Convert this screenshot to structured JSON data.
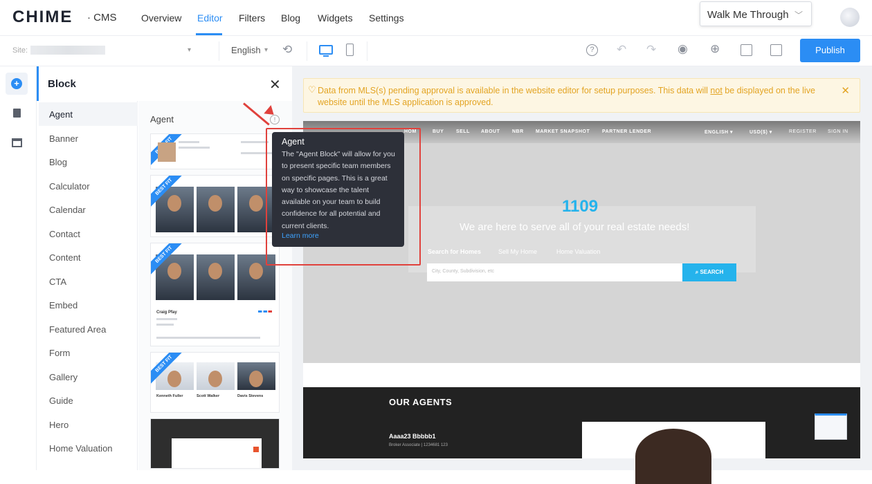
{
  "app": {
    "logo": "CHIME",
    "suffix": "· CMS"
  },
  "nav": {
    "items": [
      "Overview",
      "Editor",
      "Filters",
      "Blog",
      "Widgets",
      "Settings"
    ],
    "active": "Editor"
  },
  "walkthrough": {
    "label": "Walk Me Through"
  },
  "toolbar": {
    "site_label": "Site:",
    "language": "English",
    "publish_label": "Publish"
  },
  "block_panel": {
    "title": "Block",
    "categories": [
      "Agent",
      "Banner",
      "Blog",
      "Calculator",
      "Calendar",
      "Contact",
      "Content",
      "CTA",
      "Embed",
      "Featured Area",
      "Form",
      "Gallery",
      "Guide",
      "Hero",
      "Home Valuation"
    ],
    "active_category": "Agent",
    "section_title": "Agent",
    "badge": "BEST FIT",
    "thumb_names": {
      "card_name": "Craig Pfay",
      "row_names": [
        "Kenneth Fuller",
        "Scott Walker",
        "Davis Stevens"
      ]
    }
  },
  "tooltip": {
    "title": "Agent",
    "body": "The \"Agent Block\" will allow for you to present specific team members on specific pages. This is a great way to showcase the talent available on your team to build confidence for all potential and current clients.",
    "link": "Learn more"
  },
  "notice": {
    "text_before": "Data from MLS(s) pending approval is available in the website editor for setup purposes. This data will ",
    "text_emph": "not",
    "text_after": " be displayed on the live website until the MLS application is approved."
  },
  "preview": {
    "nav_items": [
      "HOM",
      "BUY",
      "SELL",
      "ABOUT",
      "NBR",
      "MARKET SNAPSHOT",
      "PARTNER LENDER"
    ],
    "nav_right": [
      "ENGLISH ▾",
      "USD($) ▾",
      "REGISTER",
      "SIGN IN"
    ],
    "hero_number": "1109",
    "hero_tagline": "We are here to serve all of your real estate needs!",
    "hero_tabs": [
      "Search for Homes",
      "Sell My Home",
      "Home Valuation"
    ],
    "search_placeholder": "City, County, Subdivision, etc",
    "search_button": "SEARCH",
    "agents_title": "OUR AGENTS",
    "agent_name": "Aaaa23 Bbbbb1",
    "agent_subtitle": "Broker Associate | 1234681 123"
  },
  "colors": {
    "accent": "#2b8df4",
    "notice_text": "#e3a423",
    "highlight": "#e0413c",
    "hero_accent": "#25b3ec"
  }
}
